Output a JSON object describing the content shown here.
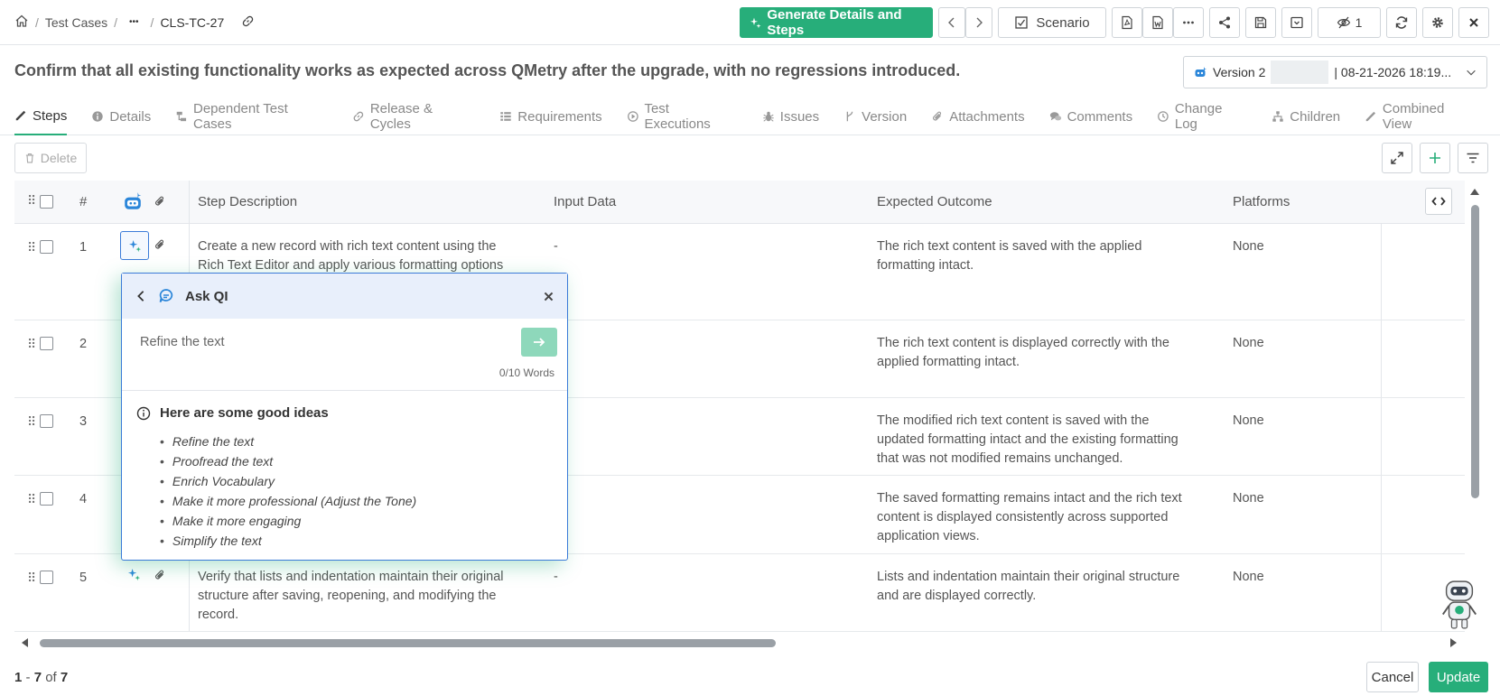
{
  "breadcrumb": {
    "root": "Test Cases",
    "ellipsis": "•••",
    "current": "CLS-TC-27",
    "sep": "/"
  },
  "toolbar": {
    "generate_label": "Generate Details and Steps",
    "scenario_label": "Scenario",
    "watch_count": "1"
  },
  "title": "Confirm that all existing functionality works as expected across QMetry after the upgrade, with no regressions introduced.",
  "version": {
    "label": "Version 2",
    "date": "| 08-21-2026 18:19..."
  },
  "tabs": [
    {
      "label": "Steps",
      "icon": "edit-icon"
    },
    {
      "label": "Details",
      "icon": "info-icon"
    },
    {
      "label": "Dependent Test Cases",
      "icon": "dependency-icon"
    },
    {
      "label": "Release & Cycles",
      "icon": "link-icon"
    },
    {
      "label": "Requirements",
      "icon": "list-icon"
    },
    {
      "label": "Test Executions",
      "icon": "play-icon"
    },
    {
      "label": "Issues",
      "icon": "bug-icon"
    },
    {
      "label": "Version",
      "icon": "branch-icon"
    },
    {
      "label": "Attachments",
      "icon": "paperclip-icon"
    },
    {
      "label": "Comments",
      "icon": "comments-icon"
    },
    {
      "label": "Change Log",
      "icon": "clock-icon"
    },
    {
      "label": "Children",
      "icon": "sitemap-icon"
    },
    {
      "label": "Combined View",
      "icon": "pencil-icon"
    }
  ],
  "delete_label": "Delete",
  "grid": {
    "headers": {
      "num": "#",
      "step": "Step Description",
      "input": "Input Data",
      "expected": "Expected Outcome",
      "platforms": "Platforms"
    },
    "rows": [
      {
        "num": "1",
        "step": "Create a new record with rich text content using the Rich Text Editor and apply various formatting options",
        "input": "-",
        "expected": "The rich text content is saved with the applied formatting intact.",
        "platforms": "None"
      },
      {
        "num": "2",
        "step": "",
        "input": "",
        "expected": "The rich text content is displayed correctly with the applied formatting intact.",
        "platforms": "None"
      },
      {
        "num": "3",
        "step": "",
        "input": "",
        "expected": "The modified rich text content is saved with the updated formatting intact and the existing formatting that was not modified remains unchanged.",
        "platforms": "None"
      },
      {
        "num": "4",
        "step": "",
        "input": "",
        "expected": "The saved formatting remains intact and the rich text content is displayed consistently across supported application views.",
        "platforms": "None"
      },
      {
        "num": "5",
        "step": "Verify that lists and indentation maintain their original structure after saving, reopening, and modifying the record.",
        "input": "-",
        "expected": "Lists and indentation maintain their original structure and are displayed correctly.",
        "platforms": "None"
      }
    ]
  },
  "footer": {
    "range_start": "1",
    "range_end": "7",
    "of": "of",
    "total": "7",
    "dash": " - ",
    "cancel_label": "Cancel",
    "update_label": "Update"
  },
  "ask_qi": {
    "title": "Ask QI",
    "input_value": "Refine the text",
    "word_count": "0/10 Words",
    "ideas_heading": "Here are some good ideas",
    "ideas": [
      "Refine the text",
      "Proofread the text",
      "Enrich Vocabulary",
      "Make it more professional (Adjust the Tone)",
      "Make it more engaging",
      "Simplify the text"
    ]
  },
  "colors": {
    "accent": "#27ae7a",
    "popup_border": "#3b7bd8",
    "popup_header": "#e8effb"
  }
}
